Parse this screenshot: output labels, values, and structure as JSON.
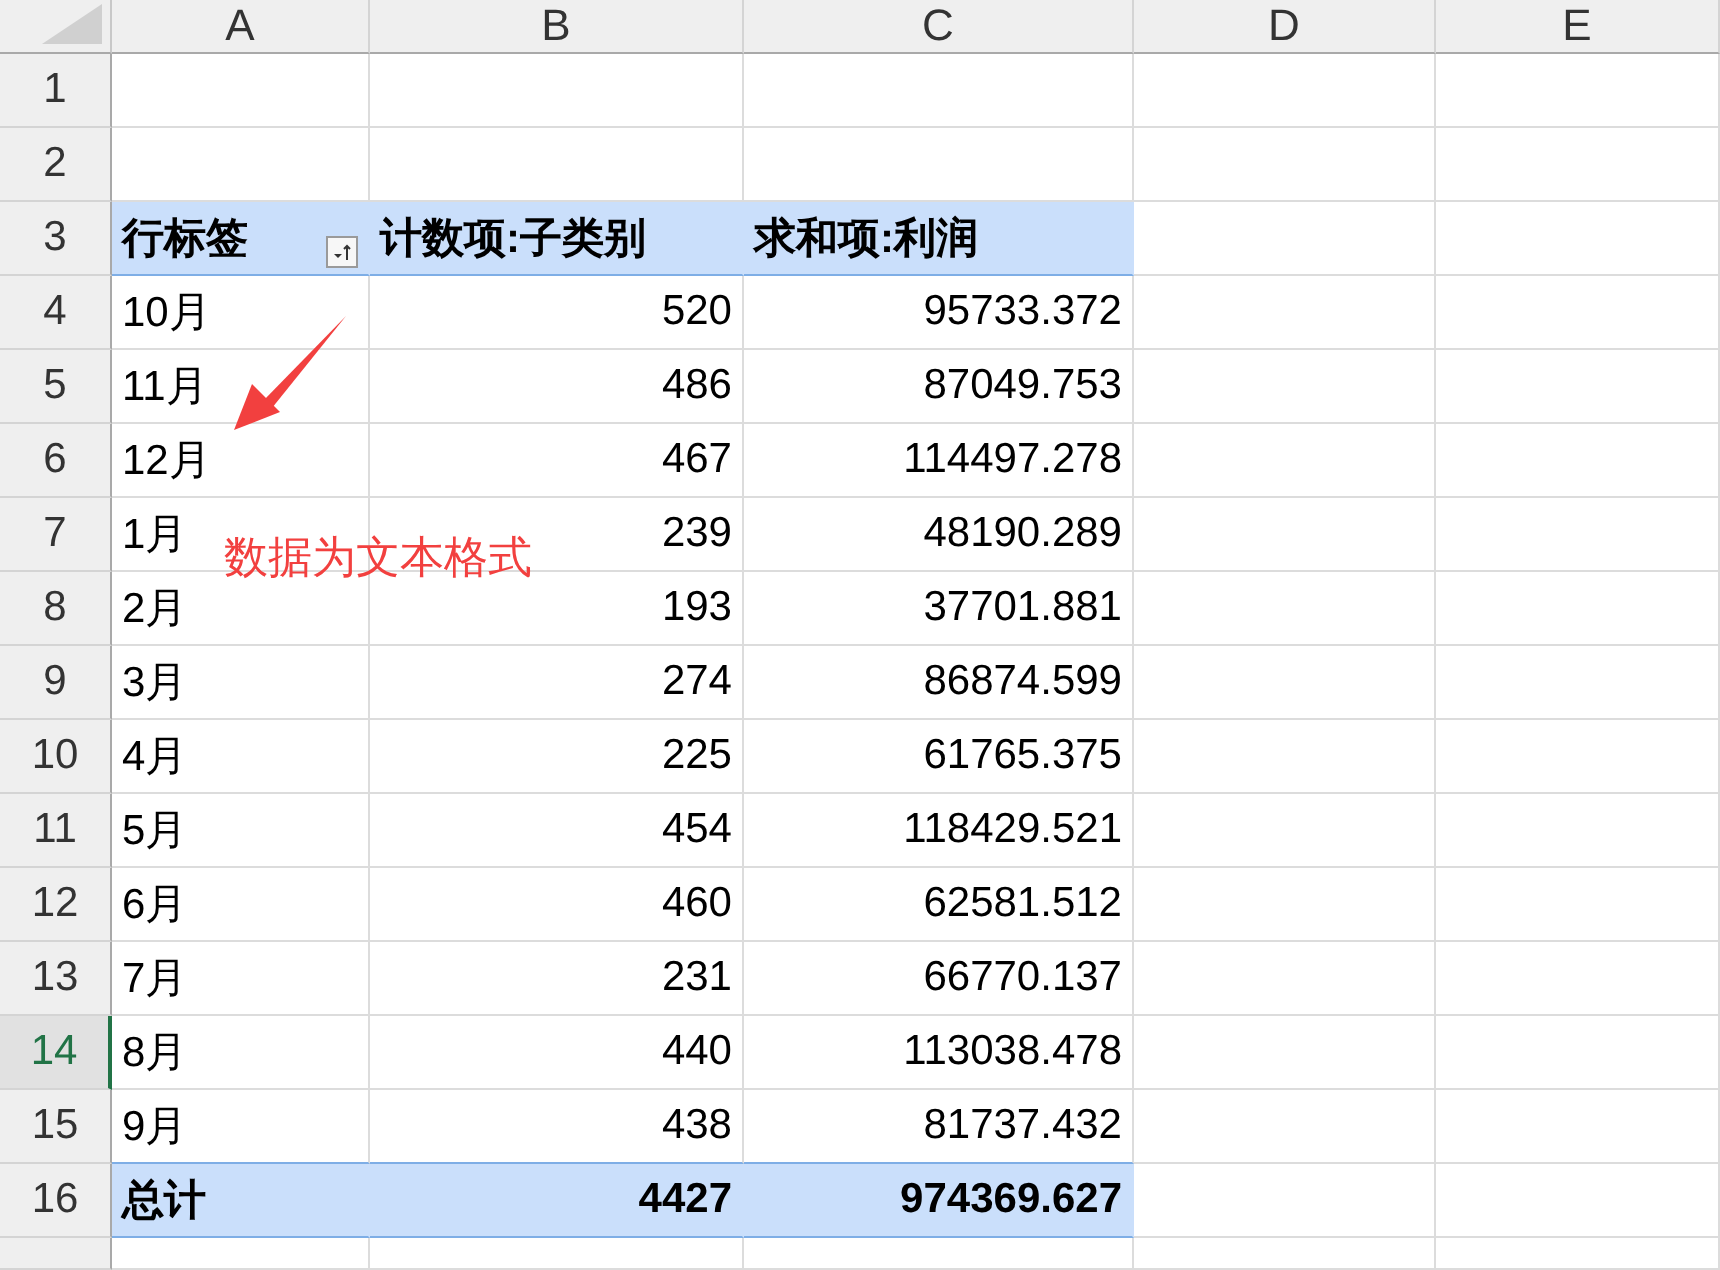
{
  "columns": [
    "A",
    "B",
    "C",
    "D",
    "E"
  ],
  "row_headers": [
    {
      "label": "1",
      "selected": false
    },
    {
      "label": "2",
      "selected": false
    },
    {
      "label": "3",
      "selected": false
    },
    {
      "label": "4",
      "selected": false
    },
    {
      "label": "5",
      "selected": false
    },
    {
      "label": "6",
      "selected": false
    },
    {
      "label": "7",
      "selected": false
    },
    {
      "label": "8",
      "selected": false
    },
    {
      "label": "9",
      "selected": false
    },
    {
      "label": "10",
      "selected": false
    },
    {
      "label": "11",
      "selected": false
    },
    {
      "label": "12",
      "selected": false
    },
    {
      "label": "13",
      "selected": false
    },
    {
      "label": "14",
      "selected": true
    },
    {
      "label": "15",
      "selected": false
    },
    {
      "label": "16",
      "selected": false
    }
  ],
  "pivot": {
    "headers": [
      "行标签",
      "计数项:子类别",
      "求和项:利润"
    ],
    "rows": [
      {
        "label": "10月",
        "count": "520",
        "sum": "95733.372"
      },
      {
        "label": "11月",
        "count": "486",
        "sum": "87049.753"
      },
      {
        "label": "12月",
        "count": "467",
        "sum": "114497.278"
      },
      {
        "label": "1月",
        "count": "239",
        "sum": "48190.289"
      },
      {
        "label": "2月",
        "count": "193",
        "sum": "37701.881"
      },
      {
        "label": "3月",
        "count": "274",
        "sum": "86874.599"
      },
      {
        "label": "4月",
        "count": "225",
        "sum": "61765.375"
      },
      {
        "label": "5月",
        "count": "454",
        "sum": "118429.521"
      },
      {
        "label": "6月",
        "count": "460",
        "sum": "62581.512"
      },
      {
        "label": "7月",
        "count": "231",
        "sum": "66770.137"
      },
      {
        "label": "8月",
        "count": "440",
        "sum": "113038.478"
      },
      {
        "label": "9月",
        "count": "438",
        "sum": "81737.432"
      }
    ],
    "total": {
      "label": "总计",
      "count": "4427",
      "sum": "974369.627"
    }
  },
  "annotation": {
    "text": "数据为文本格式"
  }
}
